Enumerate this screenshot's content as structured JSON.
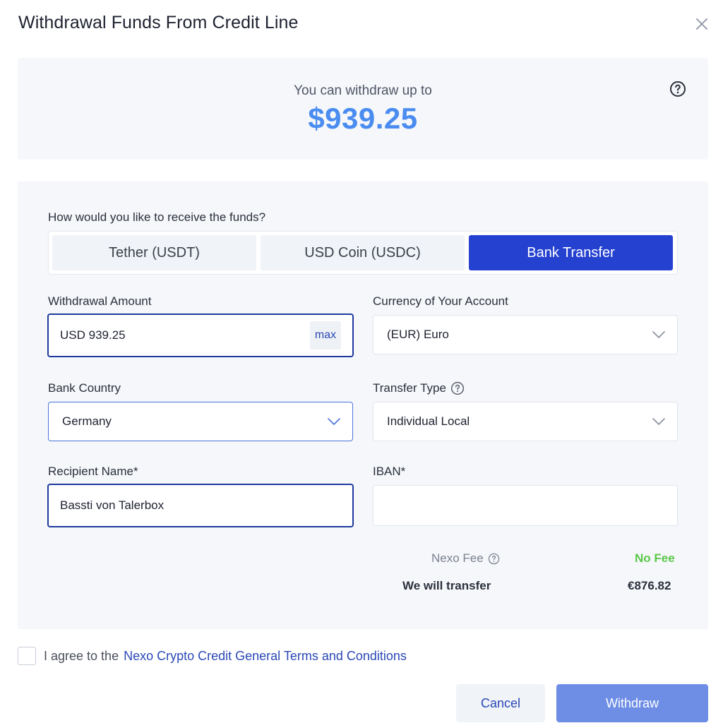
{
  "dialog": {
    "title": "Withdrawal Funds From Credit Line"
  },
  "limit": {
    "caption": "You can withdraw up to",
    "amount": "$939.25"
  },
  "method": {
    "question": "How would you like to receive the funds?",
    "options": [
      {
        "label": "Tether (USDT)",
        "selected": false
      },
      {
        "label": "USD Coin (USDC)",
        "selected": false
      },
      {
        "label": "Bank Transfer",
        "selected": true
      }
    ]
  },
  "form": {
    "withdrawal_amount": {
      "label": "Withdrawal Amount",
      "value": "USD 939.25",
      "max_label": "max"
    },
    "currency": {
      "label": "Currency of Your Account",
      "value": "(EUR) Euro"
    },
    "bank_country": {
      "label": "Bank Country",
      "value": "Germany"
    },
    "transfer_type": {
      "label": "Transfer Type",
      "value": "Individual Local"
    },
    "recipient_name": {
      "label": "Recipient Name*",
      "value": "Bassti von Talerbox"
    },
    "iban": {
      "label": "IBAN*",
      "value": ""
    }
  },
  "summary": {
    "fee_label": "Nexo Fee",
    "fee_value": "No Fee",
    "transfer_label": "We will transfer",
    "transfer_value": "€876.82"
  },
  "agreement": {
    "text": "I agree to the",
    "link": "Nexo Crypto Credit General Terms and Conditions",
    "checked": false
  },
  "actions": {
    "cancel": "Cancel",
    "withdraw": "Withdraw"
  },
  "colors": {
    "accent": "#2541d0",
    "amount_blue": "#4a8cf0",
    "fee_green": "#5cc84a",
    "withdraw_button": "#6e8ee6",
    "panel_bg": "#f5f7fa"
  },
  "icons": {
    "close": "close-icon",
    "help": "help-circle-icon",
    "dropdown": "chevron-down-icon"
  }
}
